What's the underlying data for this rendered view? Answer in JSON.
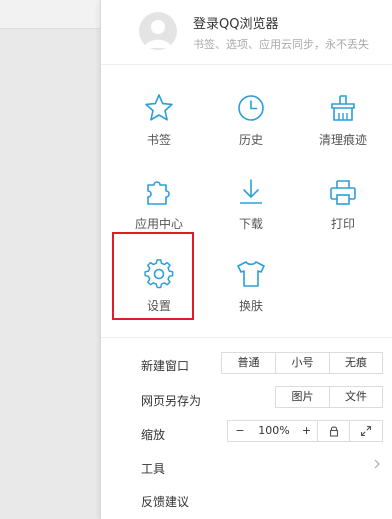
{
  "account": {
    "title": "登录QQ浏览器",
    "subtitle": "书签、选项、应用云同步，永不丢失"
  },
  "grid": [
    {
      "label": "书签",
      "icon": "star-icon"
    },
    {
      "label": "历史",
      "icon": "clock-icon"
    },
    {
      "label": "清理痕迹",
      "icon": "broom-icon"
    },
    {
      "label": "应用中心",
      "icon": "puzzle-icon"
    },
    {
      "label": "下载",
      "icon": "download-icon"
    },
    {
      "label": "打印",
      "icon": "printer-icon"
    },
    {
      "label": "设置",
      "icon": "gear-icon"
    },
    {
      "label": "换肤",
      "icon": "tshirt-icon"
    }
  ],
  "menu": {
    "new_window": {
      "label": "新建窗口",
      "options": [
        "普通",
        "小号",
        "无痕"
      ]
    },
    "save_page": {
      "label": "网页另存为",
      "options": [
        "图片",
        "文件"
      ]
    },
    "zoom": {
      "label": "缩放",
      "minus": "−",
      "value": "100%",
      "plus": "+"
    },
    "tools": {
      "label": "工具"
    },
    "feedback": {
      "label": "反馈建议"
    }
  },
  "colors": {
    "accent_icon": "#2b9fd8",
    "highlight": "#e01b24"
  }
}
